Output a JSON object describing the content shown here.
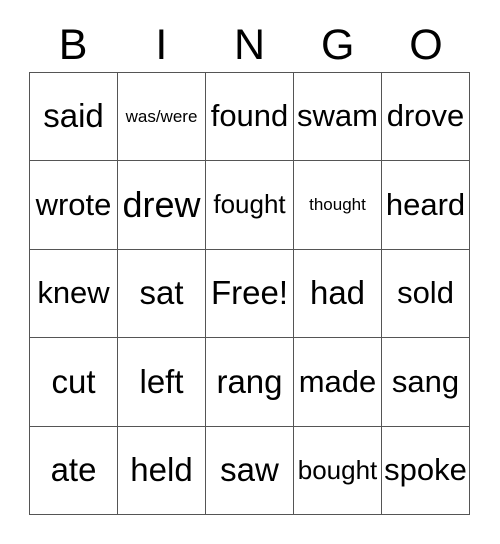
{
  "card": {
    "header": {
      "letters": [
        "B",
        "I",
        "N",
        "G",
        "O"
      ]
    },
    "grid": {
      "rows": 5,
      "columns": 5,
      "border_color": "#555555",
      "background_color": "#ffffff",
      "text_color": "#000000",
      "cells": [
        [
          {
            "label": "said",
            "size": "lg"
          },
          {
            "label": "was/were",
            "size": "xs"
          },
          {
            "label": "found",
            "size": "md"
          },
          {
            "label": "swam",
            "size": "md"
          },
          {
            "label": "drove",
            "size": "md"
          }
        ],
        [
          {
            "label": "wrote",
            "size": "md"
          },
          {
            "label": "drew",
            "size": "xl"
          },
          {
            "label": "fought",
            "size": "sm"
          },
          {
            "label": "thought",
            "size": "xs"
          },
          {
            "label": "heard",
            "size": "md"
          }
        ],
        [
          {
            "label": "knew",
            "size": "md"
          },
          {
            "label": "sat",
            "size": "lg"
          },
          {
            "label": "Free!",
            "size": "lg"
          },
          {
            "label": "had",
            "size": "lg"
          },
          {
            "label": "sold",
            "size": "md"
          }
        ],
        [
          {
            "label": "cut",
            "size": "lg"
          },
          {
            "label": "left",
            "size": "lg"
          },
          {
            "label": "rang",
            "size": "lg"
          },
          {
            "label": "made",
            "size": "md"
          },
          {
            "label": "sang",
            "size": "md"
          }
        ],
        [
          {
            "label": "ate",
            "size": "lg"
          },
          {
            "label": "held",
            "size": "lg"
          },
          {
            "label": "saw",
            "size": "lg"
          },
          {
            "label": "bought",
            "size": "sm"
          },
          {
            "label": "spoke",
            "size": "md"
          }
        ]
      ]
    }
  }
}
